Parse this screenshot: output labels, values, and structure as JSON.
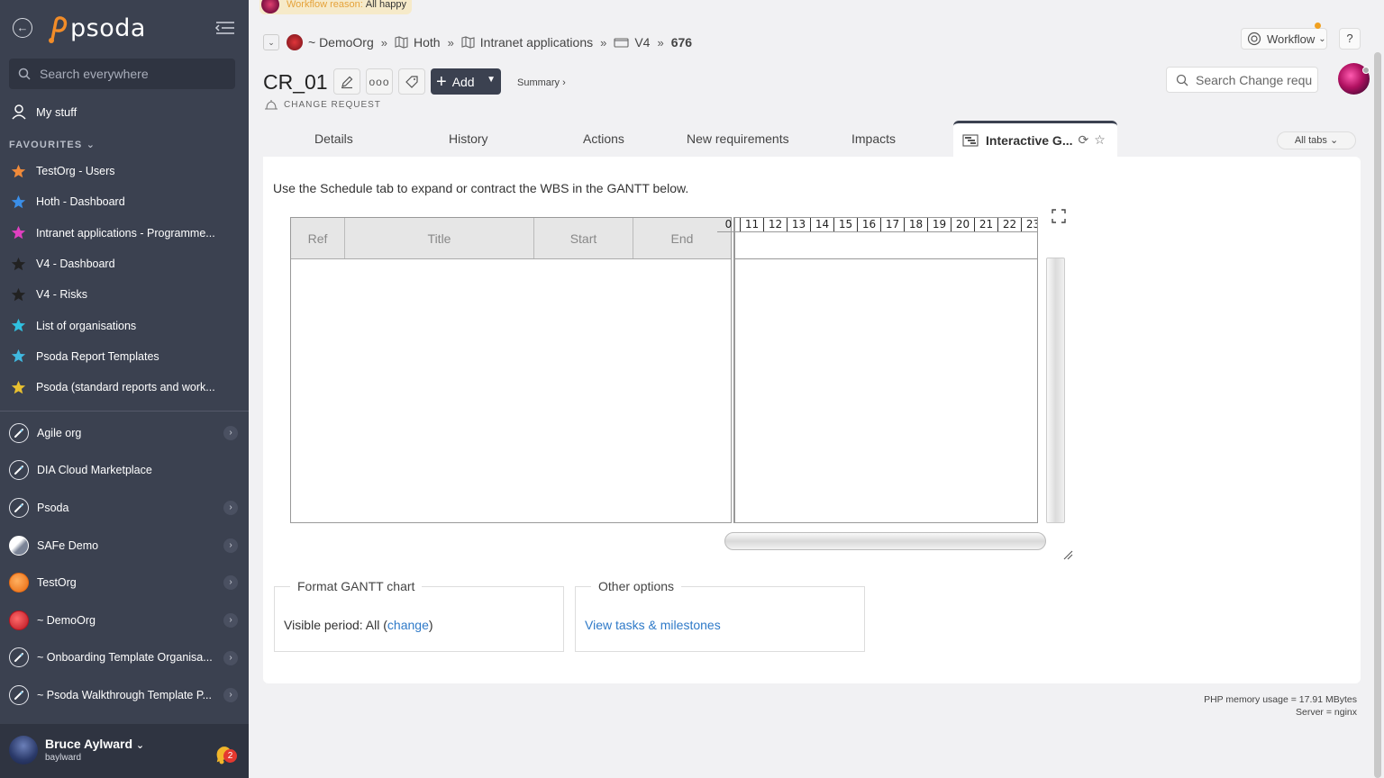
{
  "sidebar": {
    "logo_text": "psoda",
    "search_placeholder": "Search everywhere",
    "my_stuff": "My stuff",
    "favourites_heading": "FAVOURITES",
    "favourites": [
      {
        "label": "TestOrg - Users",
        "color": "#f08a3a"
      },
      {
        "label": "Hoth - Dashboard",
        "color": "#3a8ee8"
      },
      {
        "label": "Intranet applications - Programme...",
        "color": "#e040c0"
      },
      {
        "label": "V4 - Dashboard",
        "color": "#222222"
      },
      {
        "label": "V4 - Risks",
        "color": "#222222"
      },
      {
        "label": "List of organisations",
        "color": "#30c0e0"
      },
      {
        "label": "Psoda Report Templates",
        "color": "#40b8e0"
      },
      {
        "label": "Psoda (standard reports and work...",
        "color": "#e8c030"
      }
    ],
    "orgs": [
      {
        "label": "Agile org",
        "icon": "compass-icon",
        "chevron": true
      },
      {
        "label": "DIA Cloud Marketplace",
        "icon": "compass-icon",
        "chevron": false
      },
      {
        "label": "Psoda",
        "icon": "compass-icon",
        "chevron": true
      },
      {
        "label": "SAFe Demo",
        "icon": "globe-icon",
        "chevron": true
      },
      {
        "label": "TestOrg",
        "icon": "orange-ball-icon",
        "chevron": true
      },
      {
        "label": "~ DemoOrg",
        "icon": "red-ball-icon",
        "chevron": true
      },
      {
        "label": "~ Onboarding Template Organisa...",
        "icon": "compass-icon",
        "chevron": true
      },
      {
        "label": "~ Psoda Walkthrough Template P...",
        "icon": "compass-icon",
        "chevron": true
      }
    ],
    "user": {
      "name": "Bruce Aylward",
      "login": "baylward",
      "notifications": "2"
    }
  },
  "header": {
    "workflow_reason_label": "Workflow reason:",
    "workflow_reason_value": "All happy",
    "breadcrumbs": [
      "~ DemoOrg",
      "Hoth",
      "Intranet applications",
      "V4",
      "676"
    ],
    "workflow_button": "Workflow",
    "help_button": "?",
    "title": "CR_01",
    "add_button": "Add",
    "summary_link": "Summary ›",
    "subtitle": "CHANGE REQUEST",
    "record_search_placeholder": "Search Change requ"
  },
  "tabs": {
    "items": [
      "Details",
      "History",
      "Actions",
      "New requirements",
      "Impacts"
    ],
    "active": "Interactive G...",
    "all_tabs": "All tabs"
  },
  "panel": {
    "intro": "Use the Schedule tab to expand or contract the WBS in the GANTT below.",
    "gantt_columns": [
      "Ref",
      "Title",
      "Start",
      "End"
    ],
    "gantt_days": [
      "0",
      "11",
      "12",
      "13",
      "14",
      "15",
      "16",
      "17",
      "18",
      "19",
      "20",
      "21",
      "22",
      "23"
    ],
    "format_legend": "Format GANTT chart",
    "visible_period_label": "Visible period: All (",
    "visible_period_link": "change",
    "visible_period_close": ")",
    "other_legend": "Other options",
    "other_link": "View tasks & milestones"
  },
  "footer": {
    "memory": "PHP memory usage = 17.91 MBytes",
    "server": "Server = nginx"
  }
}
